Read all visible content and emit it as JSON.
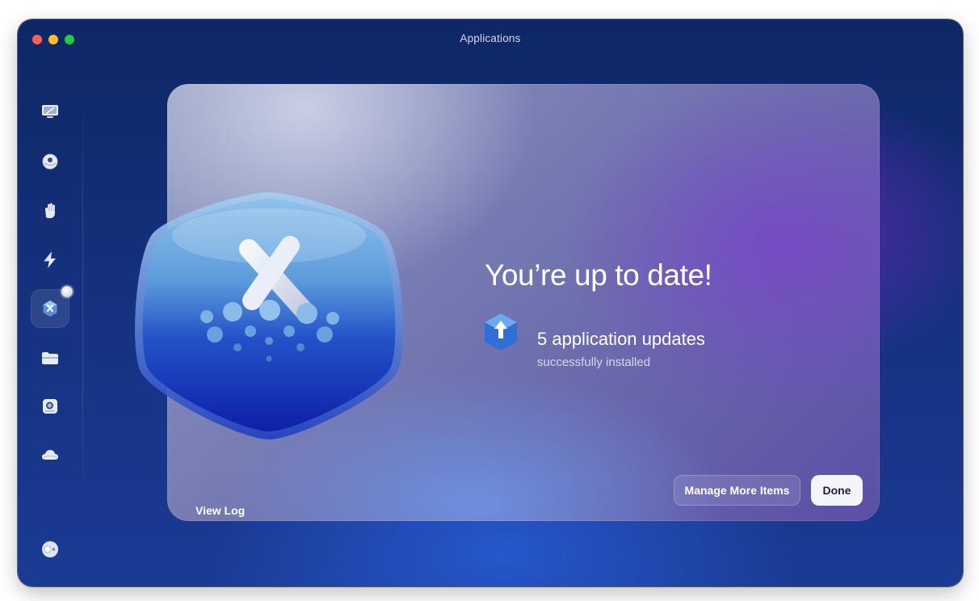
{
  "window": {
    "title": "Applications"
  },
  "sidebar": {
    "items": [
      {
        "name": "smart-scan",
        "icon": "monitor-icon"
      },
      {
        "name": "cleanup",
        "icon": "disc-icon"
      },
      {
        "name": "protection",
        "icon": "hand-icon"
      },
      {
        "name": "performance",
        "icon": "bolt-icon"
      },
      {
        "name": "applications",
        "icon": "applications-icon",
        "active": true
      },
      {
        "name": "my-clutter",
        "icon": "folder-icon"
      },
      {
        "name": "space-lens",
        "icon": "search-disk-icon"
      },
      {
        "name": "cloud",
        "icon": "cloud-icon"
      }
    ],
    "bottom_item": {
      "name": "assistant",
      "icon": "toggle-icon"
    }
  },
  "result": {
    "headline": "You’re up to date!",
    "updates_title": "5 application updates",
    "updates_subtitle": "successfully installed"
  },
  "actions": {
    "view_log": "View Log",
    "manage_more": "Manage More Items",
    "done": "Done"
  },
  "colors": {
    "accent_blue": "#2f6fd6",
    "done_button_bg": "#f4f5fa",
    "close": "#fe5f57",
    "minimize": "#febc2e",
    "maximize": "#28c840"
  }
}
